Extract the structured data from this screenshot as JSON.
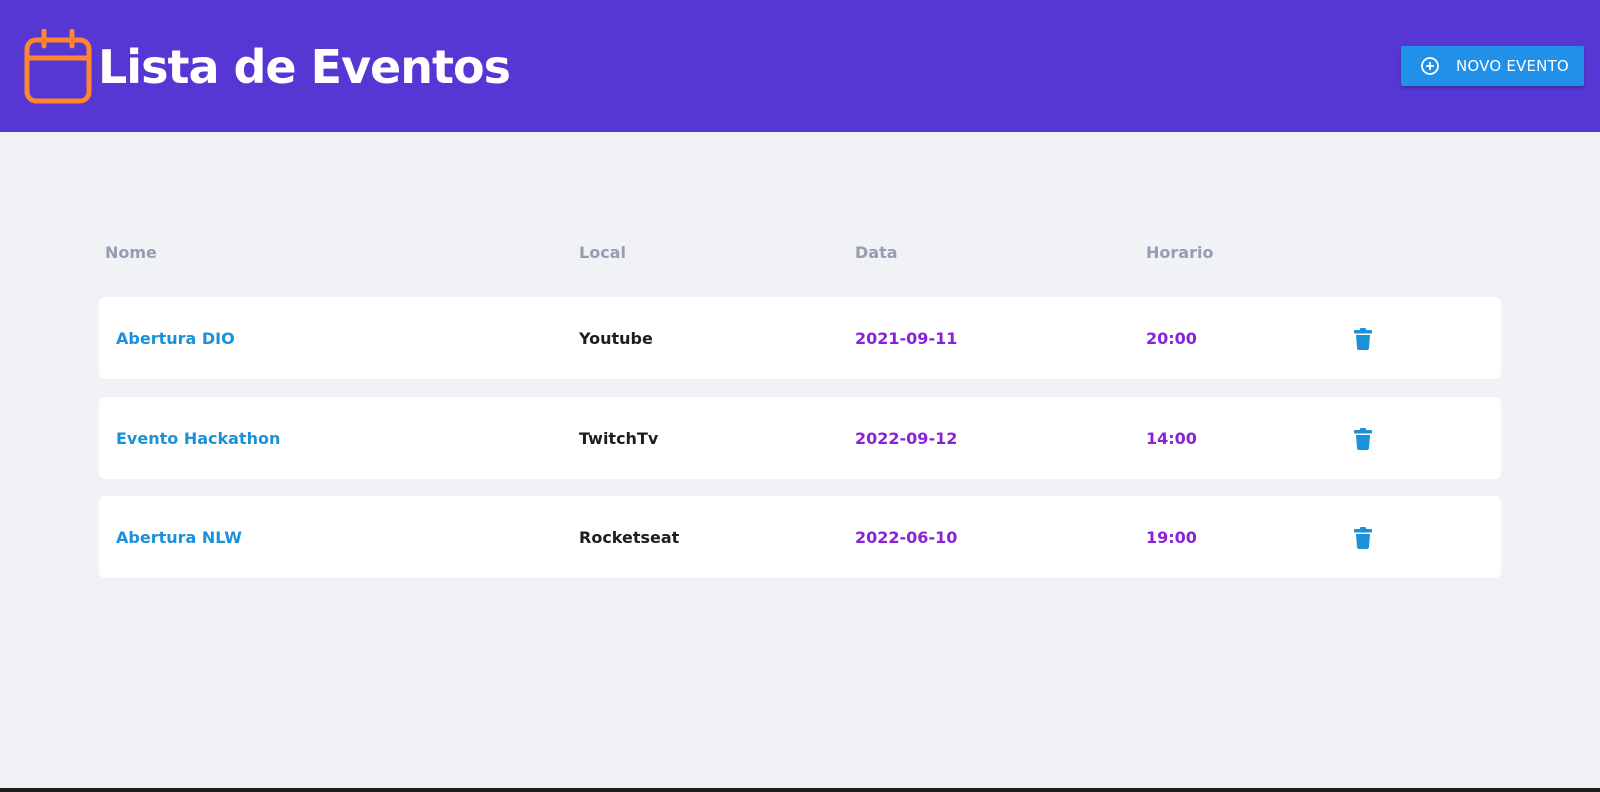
{
  "header": {
    "title": "Lista de Eventos",
    "icon": "calendar-icon",
    "new_event_label": "NOVO EVENTO",
    "new_event_icon": "plus-circle-icon"
  },
  "colors": {
    "header_bg": "#5637d4",
    "icon_accent": "#ff8533",
    "button_bg": "#2090e8",
    "name_text": "#1a91d9",
    "date_time_text": "#8a23d8",
    "header_label": "#969cb2"
  },
  "table": {
    "columns": [
      "Nome",
      "Local",
      "Data",
      "Horario"
    ],
    "rows": [
      {
        "nome": "Abertura DIO",
        "local": "Youtube",
        "data": "2021-09-11",
        "horario": "20:00",
        "action_icon": "trash-icon"
      },
      {
        "nome": "Evento Hackathon",
        "local": "TwitchTv",
        "data": "2022-09-12",
        "horario": "14:00",
        "action_icon": "trash-icon"
      },
      {
        "nome": "Abertura NLW",
        "local": "Rocketseat",
        "data": "2022-06-10",
        "horario": "19:00",
        "action_icon": "trash-icon"
      }
    ]
  }
}
